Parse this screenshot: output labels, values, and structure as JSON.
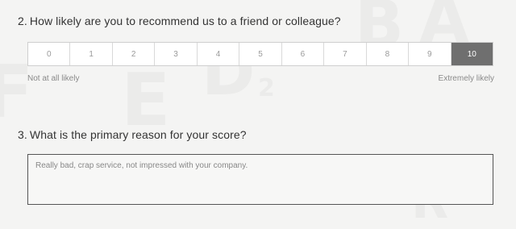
{
  "question2": {
    "number": "2.",
    "text": "How likely are you to recommend us to a friend or colleague?",
    "scale": [
      "0",
      "1",
      "2",
      "3",
      "4",
      "5",
      "6",
      "7",
      "8",
      "9",
      "10"
    ],
    "selected": "10",
    "low_label": "Not at all likely",
    "high_label": "Extremely likely"
  },
  "question3": {
    "number": "3.",
    "text": "What is the primary reason for your score?",
    "answer": "Really bad, crap service, not impressed with your company."
  },
  "colors": {
    "selected_bg": "#6f6f6f",
    "page_bg": "#f4f4f3"
  }
}
